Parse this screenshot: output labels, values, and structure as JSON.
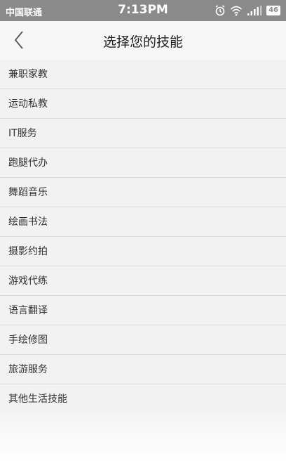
{
  "status_bar": {
    "carrier": "中国联通",
    "time": "7:13PM",
    "battery": "46",
    "icons": [
      "alarm-icon",
      "wifi-icon",
      "signal-icon",
      "battery-icon"
    ]
  },
  "nav": {
    "title": "选择您的技能",
    "back_icon": "chevron-left-icon"
  },
  "skills": [
    "兼职家教",
    "运动私教",
    "IT服务",
    "跑腿代办",
    "舞蹈音乐",
    "绘画书法",
    "摄影约拍",
    "游戏代练",
    "语言翻译",
    "手绘修图",
    "旅游服务",
    "其他生活技能"
  ],
  "colors": {
    "status_bar_bg": "#8a8a8a",
    "nav_bg": "#f7f7f7",
    "list_bg": "#f2f2f2",
    "divider": "#dcdcdc",
    "text": "#333333"
  }
}
